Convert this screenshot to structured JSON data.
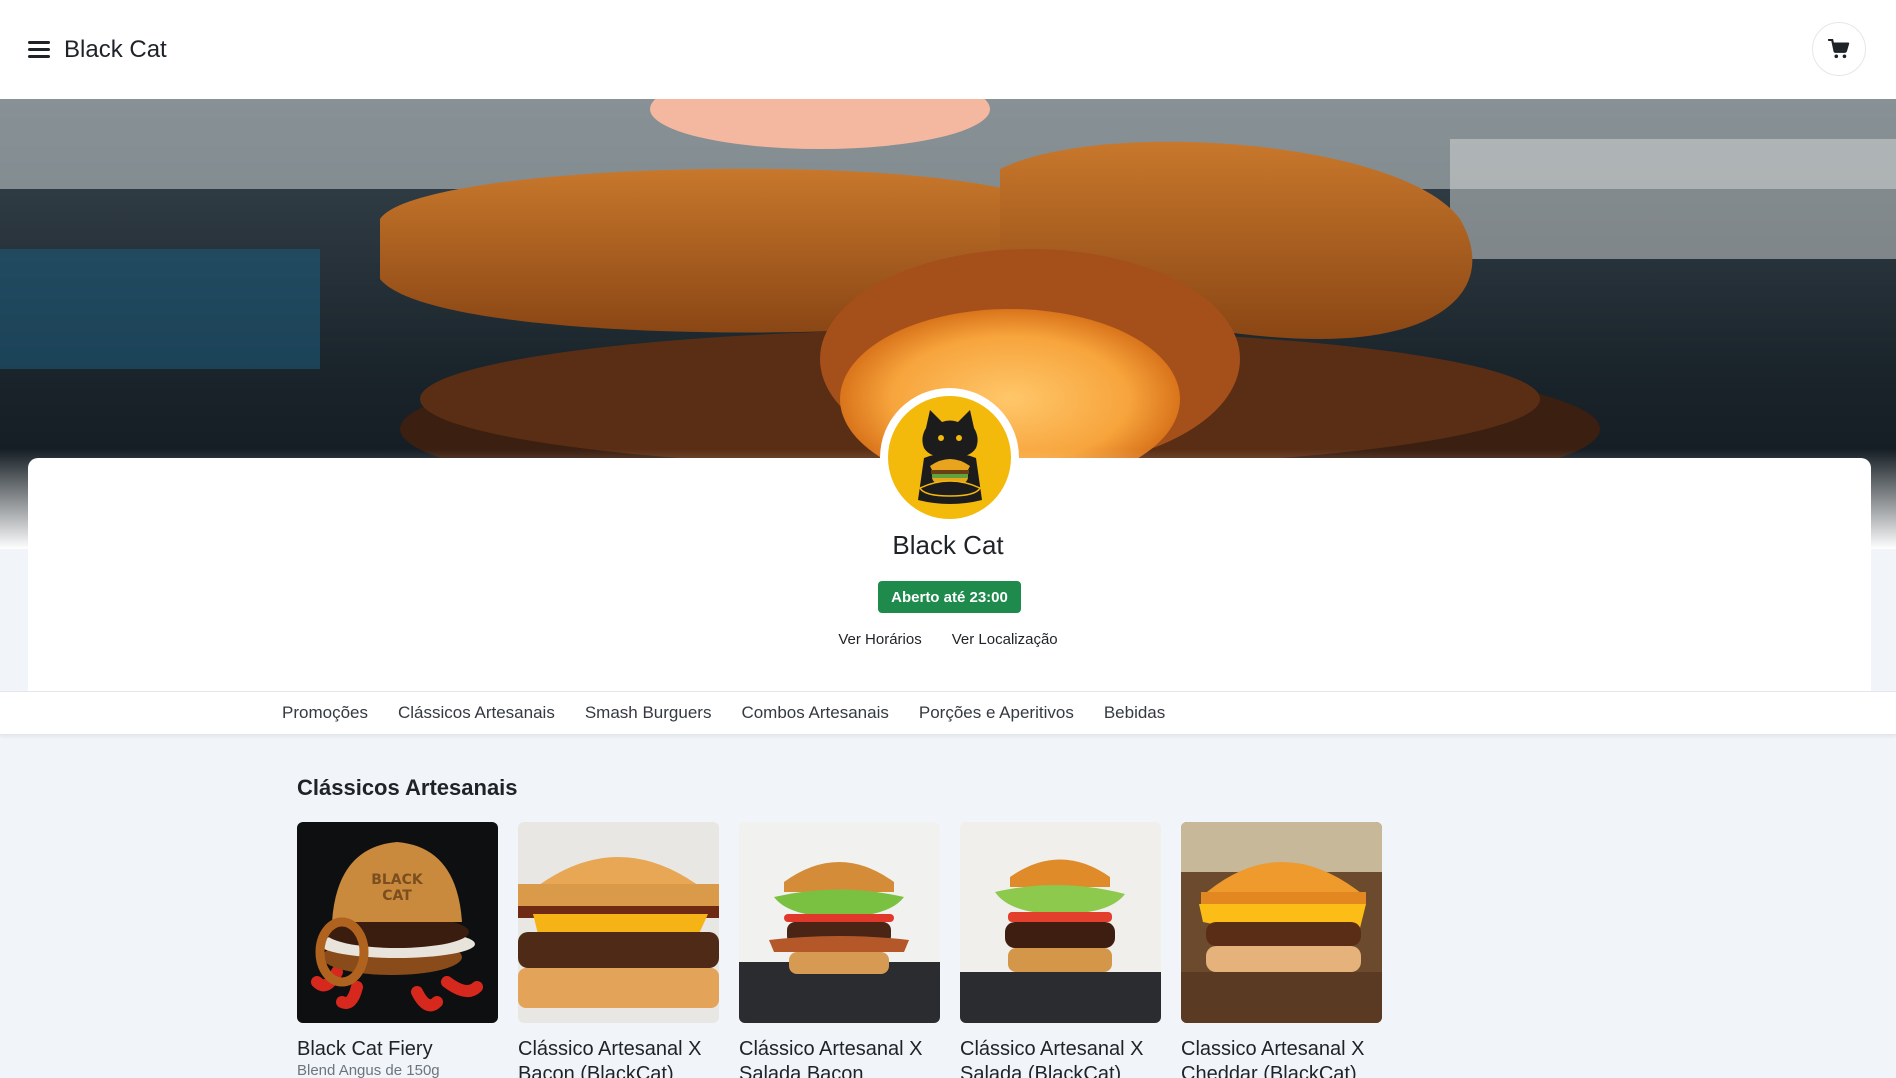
{
  "header": {
    "brand": "Black Cat",
    "menu_icon": "hamburger-menu-icon",
    "cart_icon": "shopping-cart-icon"
  },
  "store": {
    "name": "Black Cat",
    "status": "Aberto até 23:00",
    "status_color": "#1e8a4c",
    "links": {
      "hours": "Ver Horários",
      "location": "Ver Localização"
    }
  },
  "nav": {
    "categories": [
      "Promoções",
      "Clássicos Artesanais",
      "Smash Burguers",
      "Combos Artesanais",
      "Porções e Aperitivos",
      "Bebidas"
    ]
  },
  "section": {
    "title": "Clássicos Artesanais",
    "products": [
      {
        "name": "Black Cat Fiery",
        "desc": "Blend Angus de 150g"
      },
      {
        "name": "Clássico Artesanal X Bacon (BlackCat)",
        "desc": ""
      },
      {
        "name": "Clássico Artesanal X Salada Bacon",
        "desc": ""
      },
      {
        "name": "Clássico Artesanal X Salada (BlackCat)",
        "desc": ""
      },
      {
        "name": "Classico Artesanal X Cheddar (BlackCat)",
        "desc": ""
      }
    ]
  },
  "colors": {
    "accent_yellow": "#f3b90b",
    "page_bg": "#f1f4f9"
  }
}
